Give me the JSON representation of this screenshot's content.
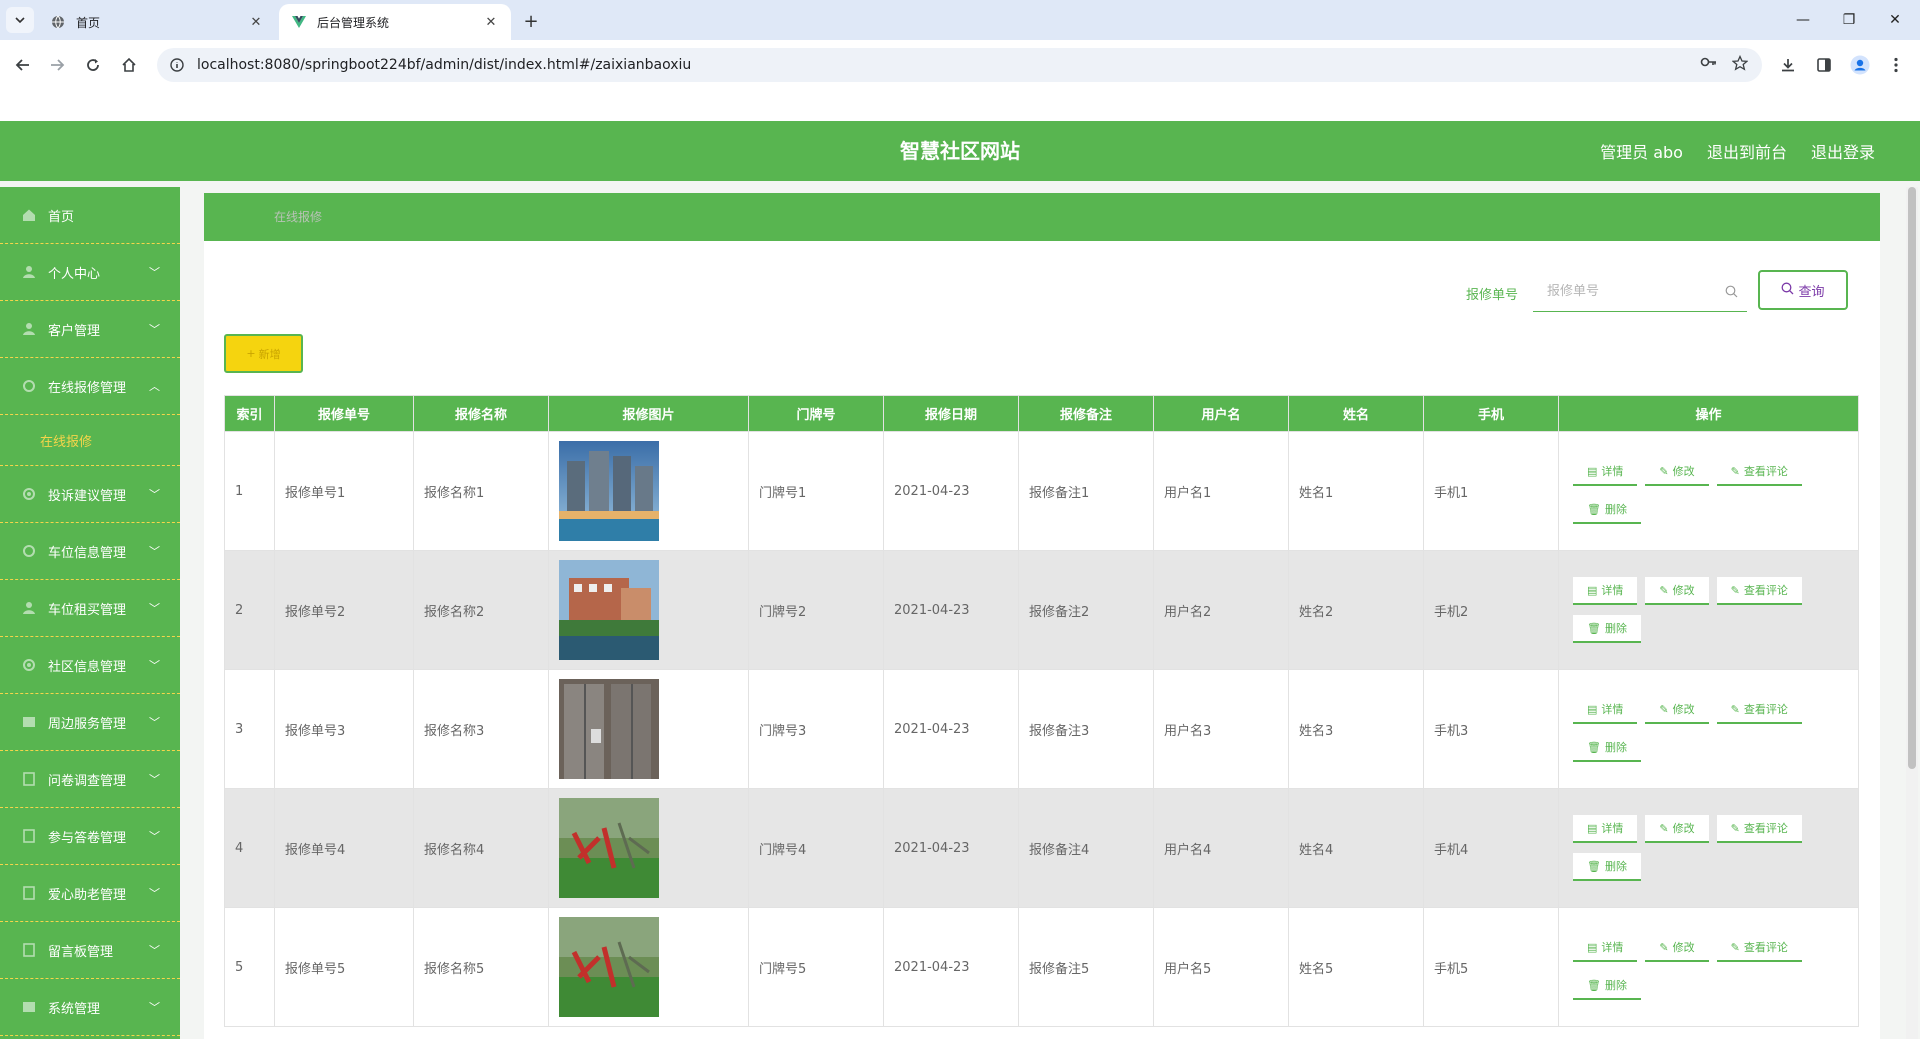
{
  "browser": {
    "tabs": [
      {
        "title": "首页",
        "active": false
      },
      {
        "title": "后台管理系统",
        "active": true
      }
    ],
    "url": "localhost:8080/springboot224bf/admin/dist/index.html#/zaixianbaoxiu"
  },
  "header": {
    "site_title": "智慧社区网站",
    "user_label": "管理员 abo",
    "back_to_front": "退出到前台",
    "logout": "退出登录"
  },
  "sidebar": {
    "items": [
      {
        "label": "首页",
        "icon": "home-icon",
        "has_arrow": false
      },
      {
        "label": "个人中心",
        "icon": "user-icon",
        "has_arrow": true
      },
      {
        "label": "客户管理",
        "icon": "user-icon",
        "has_arrow": true
      },
      {
        "label": "在线报修管理",
        "icon": "gear-icon",
        "has_arrow": true,
        "expanded": true
      },
      {
        "label": "投诉建议管理",
        "icon": "gear-icon",
        "has_arrow": true
      },
      {
        "label": "车位信息管理",
        "icon": "gear-icon",
        "has_arrow": true
      },
      {
        "label": "车位租买管理",
        "icon": "user-icon",
        "has_arrow": true
      },
      {
        "label": "社区信息管理",
        "icon": "gear-icon",
        "has_arrow": true
      },
      {
        "label": "周边服务管理",
        "icon": "grid-icon",
        "has_arrow": true
      },
      {
        "label": "问卷调查管理",
        "icon": "document-icon",
        "has_arrow": true
      },
      {
        "label": "参与答卷管理",
        "icon": "document-icon",
        "has_arrow": true
      },
      {
        "label": "爱心助老管理",
        "icon": "document-icon",
        "has_arrow": true
      },
      {
        "label": "留言板管理",
        "icon": "document-icon",
        "has_arrow": true
      },
      {
        "label": "系统管理",
        "icon": "grid-icon",
        "has_arrow": true
      }
    ],
    "sub_item": "在线报修"
  },
  "breadcrumb": "在线报修",
  "search": {
    "label": "报修单号",
    "placeholder": "报修单号",
    "query_label": "查询"
  },
  "add_label": "新增",
  "table": {
    "columns": [
      "索引",
      "报修单号",
      "报修名称",
      "报修图片",
      "门牌号",
      "报修日期",
      "报修备注",
      "用户名",
      "姓名",
      "手机",
      "操作"
    ],
    "rows": [
      {
        "index": "1",
        "no": "报修单号1",
        "name": "报修名称1",
        "image": "buildings-pool",
        "door": "门牌号1",
        "date": "2021-04-23",
        "note": "报修备注1",
        "username": "用户名1",
        "realname": "姓名1",
        "phone": "手机1"
      },
      {
        "index": "2",
        "no": "报修单号2",
        "name": "报修名称2",
        "image": "villa-pond",
        "door": "门牌号2",
        "date": "2021-04-23",
        "note": "报修备注2",
        "username": "用户名2",
        "realname": "姓名2",
        "phone": "手机2"
      },
      {
        "index": "3",
        "no": "报修单号3",
        "name": "报修名称3",
        "image": "elevator",
        "door": "门牌号3",
        "date": "2021-04-23",
        "note": "报修备注3",
        "username": "用户名3",
        "realname": "姓名3",
        "phone": "手机3"
      },
      {
        "index": "4",
        "no": "报修单号4",
        "name": "报修名称4",
        "image": "playground",
        "door": "门牌号4",
        "date": "2021-04-23",
        "note": "报修备注4",
        "username": "用户名4",
        "realname": "姓名4",
        "phone": "手机4"
      },
      {
        "index": "5",
        "no": "报修单号5",
        "name": "报修名称5",
        "image": "playground",
        "door": "门牌号5",
        "date": "2021-04-23",
        "note": "报修备注5",
        "username": "用户名5",
        "realname": "姓名5",
        "phone": "手机5"
      }
    ],
    "actions": {
      "detail": "详情",
      "edit": "修改",
      "comments": "查看评论",
      "delete": "删除"
    }
  },
  "colors": {
    "primary": "#58b550",
    "accent": "#f5d40f",
    "query_text": "#7c3aa8"
  }
}
